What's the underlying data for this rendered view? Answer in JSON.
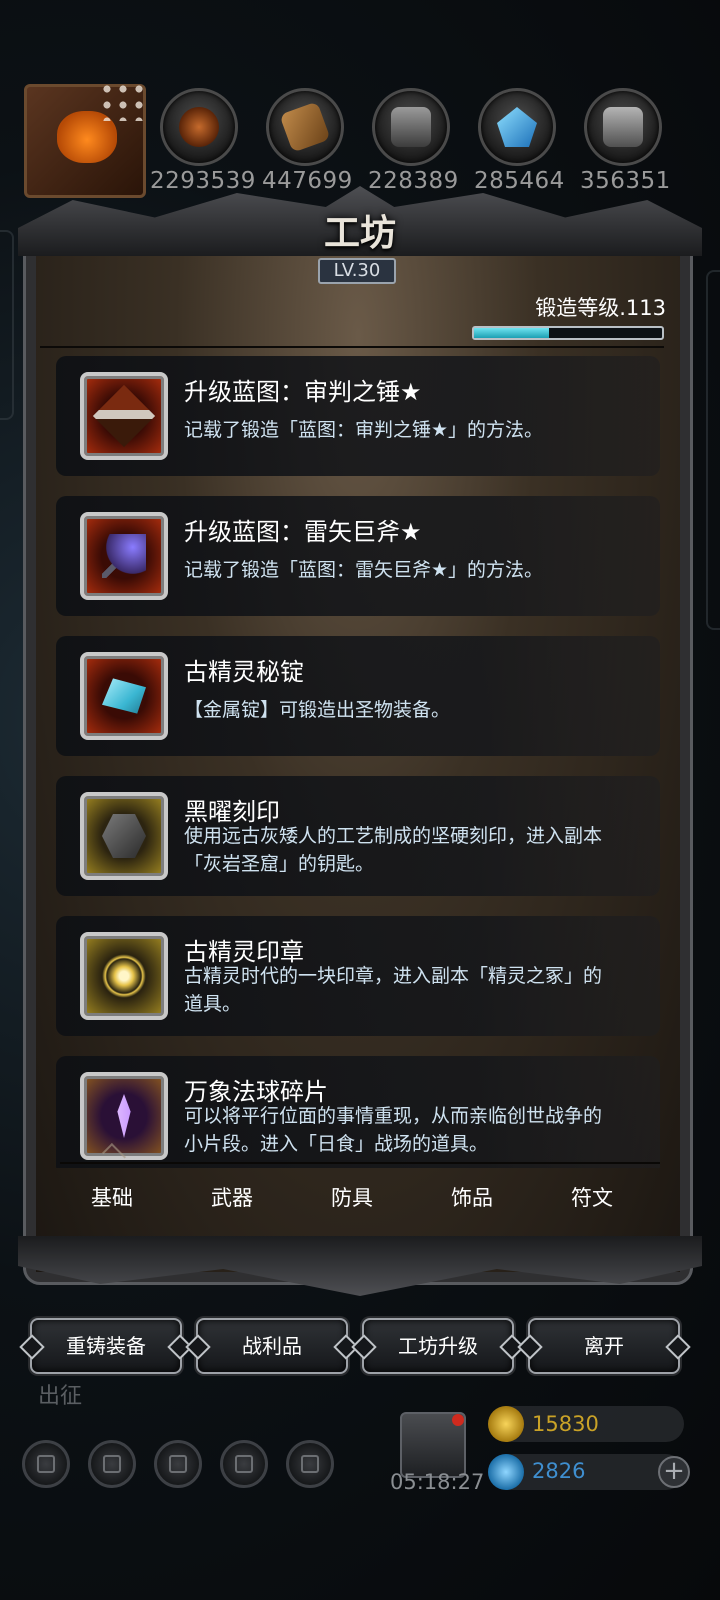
{
  "resources": {
    "values": [
      "2293539",
      "447699",
      "228389",
      "285464",
      "356351"
    ],
    "icons": [
      "avatar-pumpkin-icon",
      "ore-icon",
      "wood-icon",
      "iron-icon",
      "crystal-icon",
      "steel-icon"
    ]
  },
  "workshop": {
    "title": "工坊",
    "level": "LV.30",
    "forge_level_label": "锻造等级.113",
    "forge_progress": 0.4
  },
  "items": [
    {
      "name": "升级蓝图：审判之锤★",
      "desc": "记载了锻造「蓝图：审判之锤★」的方法。",
      "icon": "hammer-icon"
    },
    {
      "name": "升级蓝图：雷矢巨斧★",
      "desc": "记载了锻造「蓝图：雷矢巨斧★」的方法。",
      "icon": "axe-icon"
    },
    {
      "name": "古精灵秘锭",
      "desc": "【金属锭】可锻造出圣物装备。",
      "icon": "ingot-icon"
    },
    {
      "name": "黑曜刻印",
      "desc": "使用远古灰矮人的工艺制成的坚硬刻印，进入副本「灰岩圣窟」的钥匙。",
      "icon": "obsidian-seal-icon"
    },
    {
      "name": "古精灵印章",
      "desc": "古精灵时代的一块印章，进入副本「精灵之冢」的道具。",
      "icon": "elf-seal-icon"
    },
    {
      "name": "万象法球碎片",
      "desc": "可以将平行位面的事情重现，从而亲临创世战争的小片段。进入「日食」战场的道具。",
      "icon": "crystal-shard-icon"
    }
  ],
  "tabs": [
    "基础",
    "武器",
    "防具",
    "饰品",
    "符文"
  ],
  "buttons": {
    "reforge": "重铸装备",
    "loot": "战利品",
    "upgrade": "工坊升级",
    "leave": "离开"
  },
  "hud": {
    "expedition": "出征",
    "timer": "05:18:27",
    "gold": "15830",
    "gems": "2826",
    "plus": "+"
  },
  "colors": {
    "accent_cyan": "#3fc3d6",
    "desc_text": "#cfe2f0",
    "gold_text": "#c9a227",
    "gem_text": "#3f8fd0"
  }
}
